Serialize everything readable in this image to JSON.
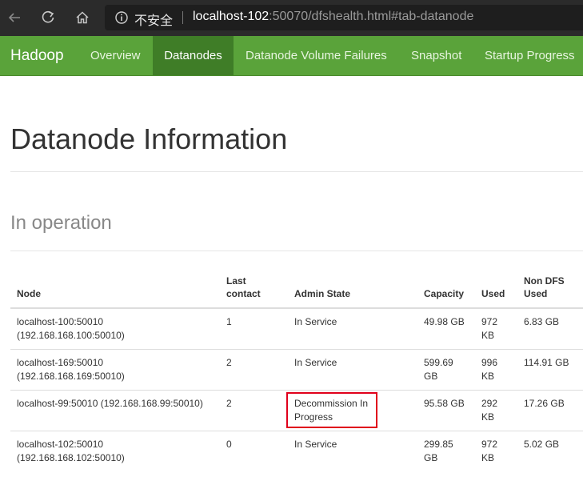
{
  "browser": {
    "security_label": "不安全",
    "url_host": "localhost-102",
    "url_rest": ":50070/dfshealth.html#tab-datanode"
  },
  "navbar": {
    "brand": "Hadoop",
    "items": [
      {
        "label": "Overview"
      },
      {
        "label": "Datanodes"
      },
      {
        "label": "Datanode Volume Failures"
      },
      {
        "label": "Snapshot"
      },
      {
        "label": "Startup Progress"
      }
    ]
  },
  "page": {
    "title": "Datanode Information",
    "section": "In operation"
  },
  "table": {
    "headers": {
      "node": "Node",
      "last_contact_1": "Last",
      "last_contact_2": "contact",
      "admin_state": "Admin State",
      "capacity": "Capacity",
      "used": "Used",
      "non_dfs_1": "Non DFS",
      "non_dfs_2": "Used"
    },
    "rows": [
      {
        "node_1": "localhost-100:50010",
        "node_2": "(192.168.168.100:50010)",
        "last_contact": "1",
        "admin_1": "In Service",
        "admin_2": "",
        "capacity_1": "49.98 GB",
        "capacity_2": "",
        "used_1": "972",
        "used_2": "KB",
        "non_dfs": "6.83 GB"
      },
      {
        "node_1": "localhost-169:50010",
        "node_2": "(192.168.168.169:50010)",
        "last_contact": "2",
        "admin_1": "In Service",
        "admin_2": "",
        "capacity_1": "599.69",
        "capacity_2": "GB",
        "used_1": "996",
        "used_2": "KB",
        "non_dfs": "114.91 GB"
      },
      {
        "node_1": "localhost-99:50010 (192.168.168.99:50010)",
        "node_2": "",
        "last_contact": "2",
        "admin_1": "Decommission In",
        "admin_2": "Progress",
        "capacity_1": "95.58 GB",
        "capacity_2": "",
        "used_1": "292",
        "used_2": "KB",
        "non_dfs": "17.26 GB"
      },
      {
        "node_1": "localhost-102:50010",
        "node_2": "(192.168.168.102:50010)",
        "last_contact": "0",
        "admin_1": "In Service",
        "admin_2": "",
        "capacity_1": "299.85",
        "capacity_2": "GB",
        "used_1": "972",
        "used_2": "KB",
        "non_dfs": "5.02 GB"
      }
    ]
  },
  "colors": {
    "navbar": "#5aa33a",
    "navbar_active": "#3f7d27",
    "highlight": "#e0001b"
  }
}
